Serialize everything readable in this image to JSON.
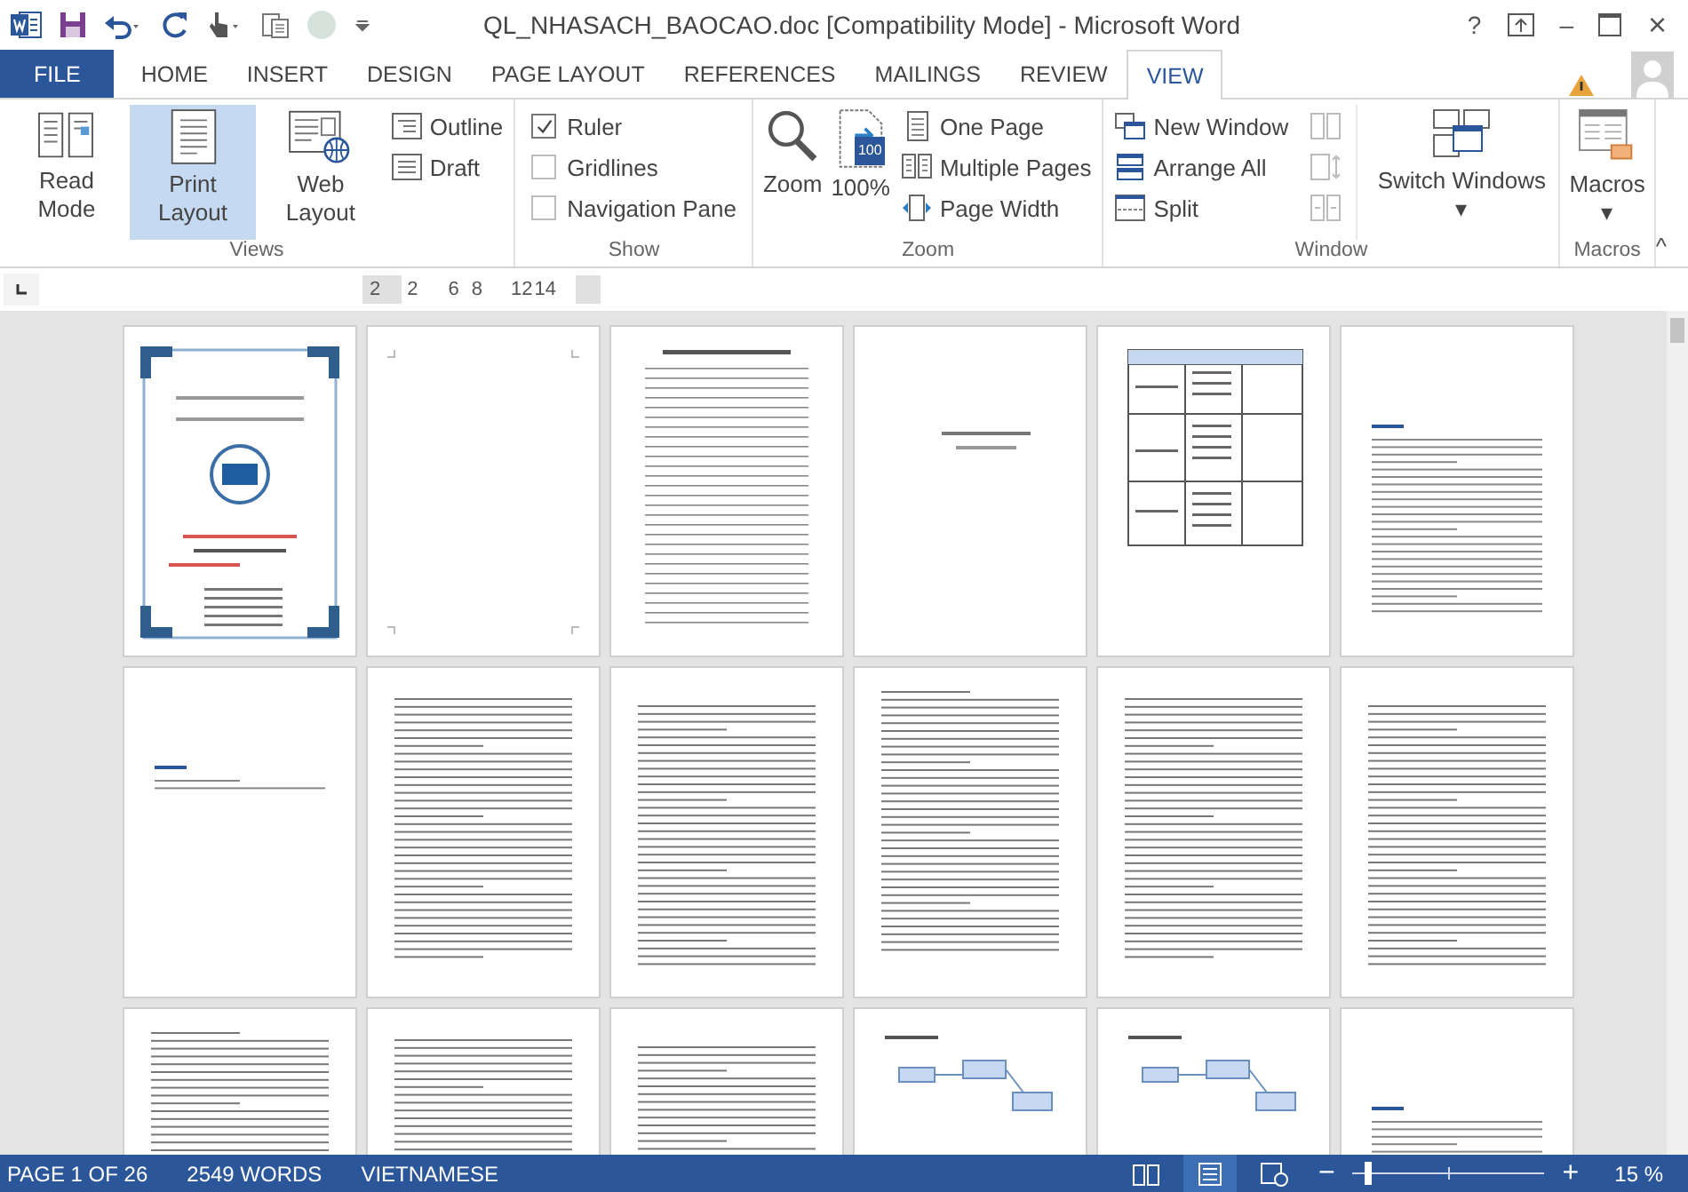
{
  "window": {
    "title": "QL_NHASACH_BAOCAO.doc [Compatibility Mode] - Microsoft Word",
    "controls": [
      "?",
      "–",
      "×"
    ]
  },
  "tabs": [
    {
      "label": "FILE",
      "kind": "file",
      "selected": false
    },
    {
      "label": "HOME",
      "kind": "tab",
      "selected": false
    },
    {
      "label": "INSERT",
      "kind": "tab",
      "selected": false
    },
    {
      "label": "DESIGN",
      "kind": "tab",
      "selected": false
    },
    {
      "label": "PAGE LAYOUT",
      "kind": "tab",
      "selected": false
    },
    {
      "label": "REFERENCES",
      "kind": "tab",
      "selected": false
    },
    {
      "label": "MAILINGS",
      "kind": "tab",
      "selected": false
    },
    {
      "label": "REVIEW",
      "kind": "tab",
      "selected": false
    },
    {
      "label": "VIEW",
      "kind": "tab",
      "selected": true
    }
  ],
  "ribbon": {
    "views": {
      "label": "Views",
      "large": [
        {
          "label": "Read Mode",
          "selected": false
        },
        {
          "label": "Print Layout",
          "selected": true
        },
        {
          "label": "Web Layout",
          "selected": false
        }
      ],
      "small": [
        {
          "label": "Outline"
        },
        {
          "label": "Draft"
        }
      ]
    },
    "show": {
      "label": "Show",
      "options": [
        {
          "label": "Ruler",
          "checked": true
        },
        {
          "label": "Gridlines",
          "checked": false
        },
        {
          "label": "Navigation Pane",
          "checked": false
        }
      ]
    },
    "zoom": {
      "label": "Zoom",
      "large": [
        {
          "label": "Zoom"
        },
        {
          "label": "100%",
          "badge": "100"
        }
      ],
      "small": [
        {
          "label": "One Page"
        },
        {
          "label": "Multiple Pages"
        },
        {
          "label": "Page Width"
        }
      ]
    },
    "window": {
      "label": "Window",
      "small": [
        {
          "label": "New Window"
        },
        {
          "label": "Arrange All"
        },
        {
          "label": "Split"
        }
      ],
      "switch": {
        "label": "Switch Windows",
        "caret": "▾"
      }
    },
    "macros": {
      "label": "Macros",
      "button": {
        "label": "Macros",
        "caret": "▾"
      }
    },
    "collapse": "^"
  },
  "ruler": {
    "marks": [
      "2",
      "2",
      "6",
      "8",
      "12",
      "14"
    ]
  },
  "pages": [
    {
      "kind": "cover"
    },
    {
      "kind": "blank"
    },
    {
      "kind": "lined"
    },
    {
      "kind": "note"
    },
    {
      "kind": "table"
    },
    {
      "kind": "toc"
    },
    {
      "kind": "short"
    },
    {
      "kind": "text"
    },
    {
      "kind": "text"
    },
    {
      "kind": "text"
    },
    {
      "kind": "text"
    },
    {
      "kind": "text"
    },
    {
      "kind": "text"
    },
    {
      "kind": "text"
    },
    {
      "kind": "text"
    },
    {
      "kind": "diagram"
    },
    {
      "kind": "diagram"
    },
    {
      "kind": "toc"
    }
  ],
  "status_bar": {
    "items": [
      "PAGE 1 OF 26",
      "2549 WORDS",
      "VIETNAMESE"
    ],
    "views": [
      {
        "selected": false
      },
      {
        "selected": true
      },
      {
        "selected": false
      }
    ],
    "zoom": {
      "minus": "−",
      "plus": "+",
      "level": 0.06,
      "reading": "15 %"
    }
  }
}
